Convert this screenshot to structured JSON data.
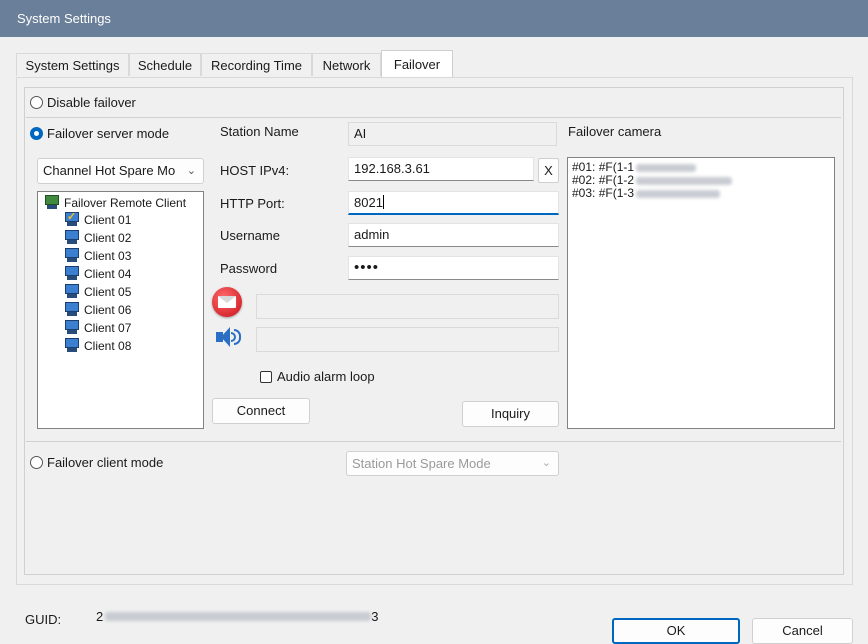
{
  "window": {
    "title": "System Settings"
  },
  "tabs": [
    {
      "label": "System Settings"
    },
    {
      "label": "Schedule"
    },
    {
      "label": "Recording Time"
    },
    {
      "label": "Network"
    },
    {
      "label": "Failover"
    }
  ],
  "modes": {
    "disable_failover": "Disable failover",
    "server_mode": "Failover server mode",
    "client_mode": "Failover client mode",
    "selected": "server_mode"
  },
  "server": {
    "spare_mode_dropdown": "Channel Hot Spare Mo",
    "tree": {
      "root": "Failover Remote Client",
      "clients": [
        "Client 01",
        "Client 02",
        "Client 03",
        "Client 04",
        "Client 05",
        "Client 06",
        "Client 07",
        "Client 08"
      ]
    },
    "station_name_label": "Station Name",
    "station_name_value": "AI",
    "host_label": "HOST IPv4:",
    "host_value": "192.168.3.61",
    "host_clear_button": "X",
    "http_port_label": "HTTP Port:",
    "http_port_value": "8021",
    "username_label": "Username",
    "username_value": "admin",
    "password_label": "Password",
    "password_value": "••••",
    "email_value": "",
    "audio_value": "",
    "audio_loop_label": "Audio alarm loop",
    "audio_loop_checked": false,
    "connect_button": "Connect",
    "inquiry_button": "Inquiry",
    "failover_camera_label": "Failover camera",
    "failover_cameras": [
      "#01: #F(1-1",
      "#02: #F(1-2",
      "#03: #F(1-3"
    ]
  },
  "client": {
    "mode_dropdown": "Station Hot Spare Mode"
  },
  "footer": {
    "guid_label": "GUID:",
    "guid_prefix": "2",
    "guid_suffix": "3",
    "ok_button": "OK",
    "cancel_button": "Cancel"
  },
  "colors": {
    "titlebar": "#6a7f99",
    "accent": "#0067c0",
    "background": "#f0f0f0"
  }
}
